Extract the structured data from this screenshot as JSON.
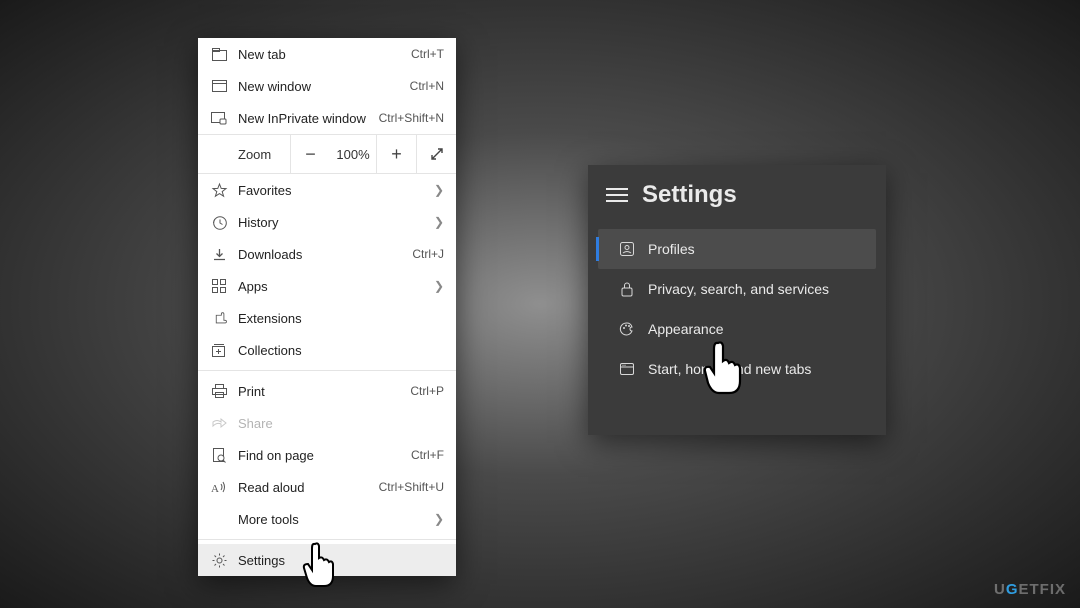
{
  "menu": {
    "new_tab": {
      "label": "New tab",
      "shortcut": "Ctrl+T"
    },
    "new_window": {
      "label": "New window",
      "shortcut": "Ctrl+N"
    },
    "new_inprivate": {
      "label": "New InPrivate window",
      "shortcut": "Ctrl+Shift+N"
    },
    "zoom": {
      "label": "Zoom",
      "minus": "−",
      "value": "100%",
      "plus": "+",
      "full": "⤢"
    },
    "favorites": {
      "label": "Favorites"
    },
    "history": {
      "label": "History"
    },
    "downloads": {
      "label": "Downloads",
      "shortcut": "Ctrl+J"
    },
    "apps": {
      "label": "Apps"
    },
    "extensions": {
      "label": "Extensions"
    },
    "collections": {
      "label": "Collections"
    },
    "print": {
      "label": "Print",
      "shortcut": "Ctrl+P"
    },
    "share": {
      "label": "Share"
    },
    "find": {
      "label": "Find on page",
      "shortcut": "Ctrl+F"
    },
    "read_aloud": {
      "label": "Read aloud",
      "shortcut": "Ctrl+Shift+U"
    },
    "more_tools": {
      "label": "More tools"
    },
    "settings": {
      "label": "Settings"
    }
  },
  "settings": {
    "title": "Settings",
    "items": {
      "profiles": {
        "label": "Profiles"
      },
      "privacy": {
        "label": "Privacy, search, and services"
      },
      "appearance": {
        "label": "Appearance"
      },
      "start": {
        "label": "Start, home, and new tabs"
      }
    }
  },
  "watermark": {
    "pre": "U",
    "accent": "G",
    "post": "ETFIX"
  }
}
